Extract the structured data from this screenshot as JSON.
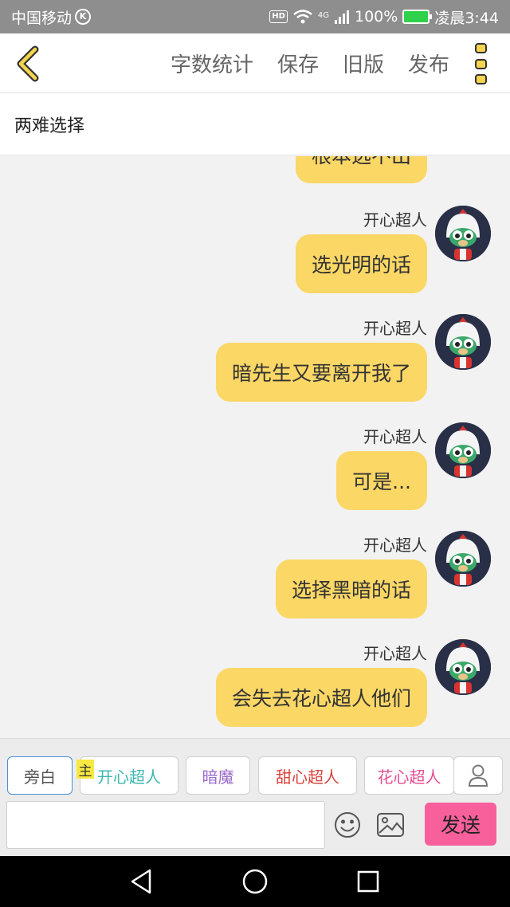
{
  "status_bar": {
    "carrier": "中国移动",
    "carrier_badge": "K",
    "hd": "HD",
    "network": "4G",
    "battery": "100%",
    "time": "凌晨3:44"
  },
  "toolbar": {
    "actions": [
      {
        "label": "字数统计"
      },
      {
        "label": "保存"
      },
      {
        "label": "旧版"
      },
      {
        "label": "发布"
      }
    ]
  },
  "title": "两难选择",
  "chat": {
    "partial_message": "根本选不出",
    "messages": [
      {
        "sender": "开心超人",
        "text": "选光明的话"
      },
      {
        "sender": "开心超人",
        "text": "暗先生又要离开我了"
      },
      {
        "sender": "开心超人",
        "text": "可是..."
      },
      {
        "sender": "开心超人",
        "text": "选择黑暗的话"
      },
      {
        "sender": "开心超人",
        "text": "会失去花心超人他们"
      }
    ]
  },
  "roles": {
    "main_tag": "主",
    "items": [
      {
        "label": "旁白",
        "color": "#555555"
      },
      {
        "label": "开心超人",
        "color": "#3bb7b0"
      },
      {
        "label": "暗魔",
        "color": "#9b6cc9"
      },
      {
        "label": "甜心超人",
        "color": "#d9443e"
      },
      {
        "label": "花心超人",
        "color": "#e54d92"
      }
    ]
  },
  "composer": {
    "input_value": "",
    "send_label": "发送"
  },
  "colors": {
    "bubble": "#fbd766",
    "send": "#f7609a",
    "accent_icon": "#f5d44e"
  }
}
